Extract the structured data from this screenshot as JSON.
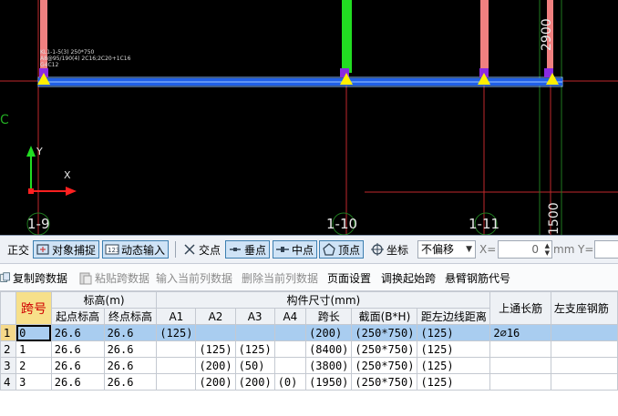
{
  "cad": {
    "beam_label_line1": "KL1-1-5(3) 250*750",
    "beam_label_line2": "A8@95/190(4) 2C16;2C20+1C16",
    "beam_label_line3": "G4C12",
    "axis_labels": [
      "1-9",
      "1-10",
      "1-11"
    ],
    "dim_top": "2900",
    "dim_bottom": "1500",
    "ucs_y": "Y",
    "ucs_x": "X",
    "left_letter": "C"
  },
  "snapbar": {
    "ortho": "正交",
    "object_snap": "对象捕捉",
    "dynamic_input": "动态输入",
    "intersection": "交点",
    "perpendicular": "垂点",
    "midpoint": "中点",
    "vertex": "顶点",
    "coordinate": "坐标",
    "offset_select": "不偏移",
    "x_label": "X=",
    "x_value": "0",
    "unit": "mm",
    "y_label": "Y="
  },
  "toolbar2": {
    "copy_span": "复制跨数据",
    "paste_span": "粘贴跨数据",
    "input_current": "输入当前列数据",
    "delete_current": "删除当前列数据",
    "page_setup": "页面设置",
    "adjust_start": "调换起始跨",
    "cantilever_code": "悬臂钢筋代号"
  },
  "grid": {
    "headers": {
      "span_no": "跨号",
      "elevation": "标高(m)",
      "start_elev": "起点标高",
      "end_elev": "终点标高",
      "member_size": "构件尺寸(mm)",
      "a1": "A1",
      "a2": "A2",
      "a3": "A3",
      "a4": "A4",
      "span_len": "跨长",
      "section": "截面(B*H)",
      "dist_left": "距左边线距离",
      "top_long_bar": "上通长筋",
      "left_support": "左支座钢筋"
    },
    "rows": [
      {
        "idx": "1",
        "span": "0",
        "start": "26.6",
        "end": "26.6",
        "a1": "(125)",
        "a2": "",
        "a3": "",
        "a4": "",
        "len": "(200)",
        "section": "(250*750)",
        "dist": "(125)",
        "top_bar": "2⌀16",
        "left": ""
      },
      {
        "idx": "2",
        "span": "1",
        "start": "26.6",
        "end": "26.6",
        "a1": "",
        "a2": "(125)",
        "a3": "(125)",
        "a4": "",
        "len": "(8400)",
        "section": "(250*750)",
        "dist": "(125)",
        "top_bar": "",
        "left": ""
      },
      {
        "idx": "3",
        "span": "2",
        "start": "26.6",
        "end": "26.6",
        "a1": "",
        "a2": "(200)",
        "a3": "(50)",
        "a4": "",
        "len": "(3800)",
        "section": "(250*750)",
        "dist": "(125)",
        "top_bar": "",
        "left": ""
      },
      {
        "idx": "4",
        "span": "3",
        "start": "26.6",
        "end": "26.6",
        "a1": "",
        "a2": "(200)",
        "a3": "(200)",
        "a4": "(0)",
        "len": "(1950)",
        "section": "(250*750)",
        "dist": "(125)",
        "top_bar": "",
        "left": ""
      }
    ]
  }
}
